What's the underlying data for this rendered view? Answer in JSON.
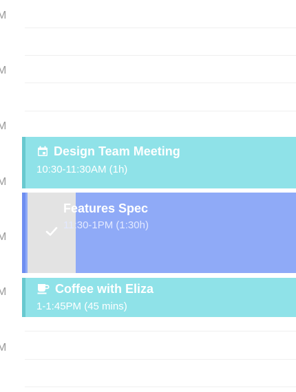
{
  "gutter": {
    "labels": [
      "M",
      "M",
      "M",
      "M",
      "M",
      "M",
      "M"
    ]
  },
  "events": [
    {
      "title": "Design Team Meeting",
      "time": "10:30-11:30AM (1h)",
      "icon": "calendar-icon",
      "color": "#8fe2e8",
      "completed": false
    },
    {
      "title": "Features Spec",
      "time": "11:30-1PM (1:30h)",
      "icon": "checkmark-icon",
      "color": "#8faaf7",
      "completed": true
    },
    {
      "title": "Coffee with Eliza",
      "time": "1-1:45PM (45 mins)",
      "icon": "coffee-cup-icon",
      "color": "#8fe2e8",
      "completed": false
    }
  ]
}
